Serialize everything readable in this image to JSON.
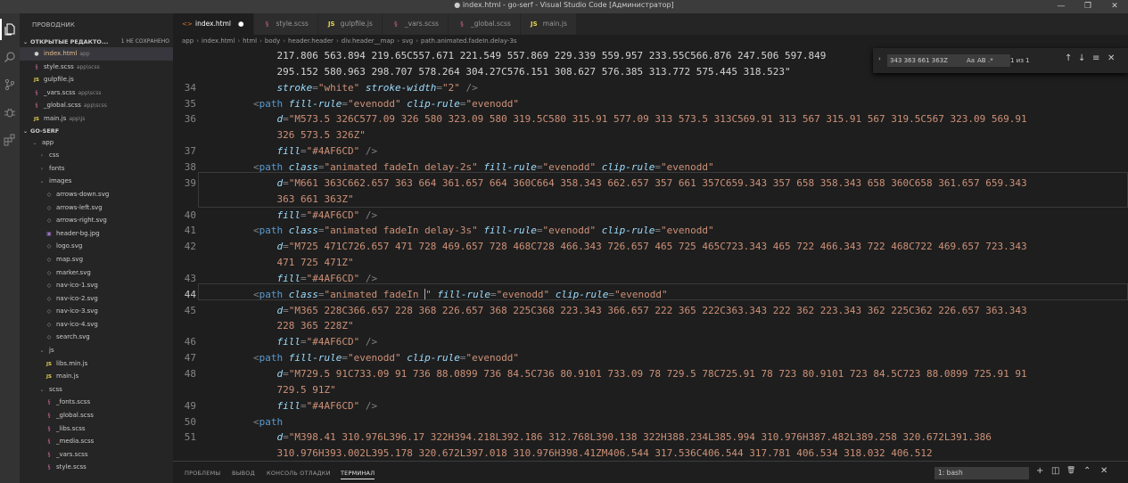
{
  "window": {
    "title": "● index.html - go-serf - Visual Studio Code [Администратор]",
    "controls": {
      "minimize": "—",
      "maximize": "❐",
      "close": "✕"
    }
  },
  "activity": [
    "files-icon",
    "search-icon",
    "source-control-icon",
    "debug-icon",
    "extensions-icon"
  ],
  "sidebar": {
    "header": "ПРОВОДНИК",
    "open_editors": {
      "label": "ОТКРЫТЫЕ РЕДАКТО...",
      "badge": "1 НЕ СОХРАНЕНО"
    },
    "open_files": [
      {
        "icon": "html",
        "name": "index.html",
        "path": "app",
        "modified": true
      },
      {
        "icon": "scss",
        "name": "style.scss",
        "path": "app\\scss"
      },
      {
        "icon": "js",
        "name": "gulpfile.js",
        "path": ""
      },
      {
        "icon": "scss",
        "name": "_vars.scss",
        "path": "app\\scss"
      },
      {
        "icon": "scss",
        "name": "_global.scss",
        "path": "app\\scss"
      },
      {
        "icon": "js",
        "name": "main.js",
        "path": "app\\js"
      }
    ],
    "project": "GO-SERF",
    "tree": [
      {
        "indent": 1,
        "type": "folder-open",
        "name": "app"
      },
      {
        "indent": 2,
        "type": "folder",
        "name": "css"
      },
      {
        "indent": 2,
        "type": "folder",
        "name": "fonts"
      },
      {
        "indent": 2,
        "type": "folder-open",
        "name": "images"
      },
      {
        "indent": 3,
        "type": "svg",
        "name": "arrows-down.svg"
      },
      {
        "indent": 3,
        "type": "svg",
        "name": "arrows-left.svg"
      },
      {
        "indent": 3,
        "type": "svg",
        "name": "arrows-right.svg"
      },
      {
        "indent": 3,
        "type": "img",
        "name": "header-bg.jpg"
      },
      {
        "indent": 3,
        "type": "svg",
        "name": "logo.svg"
      },
      {
        "indent": 3,
        "type": "svg",
        "name": "map.svg"
      },
      {
        "indent": 3,
        "type": "svg",
        "name": "marker.svg"
      },
      {
        "indent": 3,
        "type": "svg",
        "name": "nav-ico-1.svg"
      },
      {
        "indent": 3,
        "type": "svg",
        "name": "nav-ico-2.svg"
      },
      {
        "indent": 3,
        "type": "svg",
        "name": "nav-ico-3.svg"
      },
      {
        "indent": 3,
        "type": "svg",
        "name": "nav-ico-4.svg"
      },
      {
        "indent": 3,
        "type": "svg",
        "name": "search.svg"
      },
      {
        "indent": 2,
        "type": "folder-open",
        "name": "js"
      },
      {
        "indent": 3,
        "type": "js",
        "name": "libs.min.js"
      },
      {
        "indent": 3,
        "type": "js",
        "name": "main.js"
      },
      {
        "indent": 2,
        "type": "folder-open",
        "name": "scss"
      },
      {
        "indent": 3,
        "type": "scss",
        "name": "_fonts.scss"
      },
      {
        "indent": 3,
        "type": "scss",
        "name": "_global.scss"
      },
      {
        "indent": 3,
        "type": "scss",
        "name": "_libs.scss"
      },
      {
        "indent": 3,
        "type": "scss",
        "name": "_media.scss"
      },
      {
        "indent": 3,
        "type": "scss",
        "name": "_vars.scss"
      },
      {
        "indent": 3,
        "type": "scss",
        "name": "style.scss"
      }
    ]
  },
  "tabs": [
    {
      "icon": "html",
      "label": "index.html",
      "active": true,
      "dot": "●"
    },
    {
      "icon": "scss",
      "label": "style.scss"
    },
    {
      "icon": "js",
      "label": "gulpfile.js"
    },
    {
      "icon": "scss",
      "label": "_vars.scss"
    },
    {
      "icon": "scss",
      "label": "_global.scss"
    },
    {
      "icon": "js",
      "label": "main.js"
    }
  ],
  "breadcrumb": [
    "app",
    "index.html",
    "html",
    "body",
    "header.header",
    "div.header__map",
    "svg",
    "path.animated.fadeIn.delay-3s"
  ],
  "find": {
    "query": "343 363 661 363Z",
    "opt_case": "Aa",
    "opt_word": "AB",
    "opt_regex": ".*",
    "count": "1 из 1",
    "prev": "↑",
    "next": "↓",
    "menu": "≡",
    "close": "✕",
    "arrow": "›"
  },
  "editor": {
    "current_line": "44",
    "lines": [
      {
        "num": "",
        "html": "    217.806 563.894 219.65C557.671 221.549 557.869 229.339 559.957 233.55C566.876 247.506 597.849"
      },
      {
        "num": "",
        "html": "    295.152 580.963 298.707 578.264 304.27C576.151 308.627 576.385 313.772 575.445 318.523\""
      },
      {
        "num": "34",
        "html": "    <span class='attr'>stroke</span><span class='pun'>=</span><span class='val'>\"white\"</span> <span class='attr'>stroke-width</span><span class='pun'>=</span><span class='val'>\"2\"</span> <span class='pun'>/&gt;</span>"
      },
      {
        "num": "35",
        "html": "<span class='pun'>&lt;</span><span class='tag'>path</span> <span class='attr'>fill-rule</span><span class='pun'>=</span><span class='val'>\"evenodd\"</span> <span class='attr'>clip-rule</span><span class='pun'>=</span><span class='val'>\"evenodd\"</span>"
      },
      {
        "num": "36",
        "html": "    <span class='attr'>d</span><span class='pun'>=</span><span class='val'>\"M573.5 326C577.09 326 580 323.09 580 319.5C580 315.91 577.09 313 573.5 313C569.91 313 567 315.91 567 319.5C567 323.09 569.91</span>"
      },
      {
        "num": "",
        "html": "    <span class='val'>326 573.5 326Z\"</span>"
      },
      {
        "num": "37",
        "html": "    <span class='attr'>fill</span><span class='pun'>=</span><span class='val'>\"#4AF6CD\"</span> <span class='pun'>/&gt;</span>"
      },
      {
        "num": "38",
        "html": "<span class='pun'>&lt;</span><span class='tag'>path</span> <span class='attr'>class</span><span class='pun'>=</span><span class='val'>\"animated fadeIn delay-2s\"</span> <span class='attr'>fill-rule</span><span class='pun'>=</span><span class='val'>\"evenodd\"</span> <span class='attr'>clip-rule</span><span class='pun'>=</span><span class='val'>\"evenodd\"</span>"
      },
      {
        "num": "39",
        "html": "    <span class='attr'>d</span><span class='pun'>=</span><span class='val'>\"M661 363C662.657 363 664 361.657 664 360C664 358.343 662.657 357 661 357C659.343 357 658 358.343 658 360C658 361.657 659.343</span>"
      },
      {
        "num": "",
        "html": "    <span class='val'>363 661 363Z\"</span>"
      },
      {
        "num": "40",
        "html": "    <span class='attr'>fill</span><span class='pun'>=</span><span class='val'>\"#4AF6CD\"</span> <span class='pun'>/&gt;</span>"
      },
      {
        "num": "41",
        "html": "<span class='pun'>&lt;</span><span class='tag'>path</span> <span class='attr'>class</span><span class='pun'>=</span><span class='val'>\"animated fadeIn delay-3s\"</span> <span class='attr'>fill-rule</span><span class='pun'>=</span><span class='val'>\"evenodd\"</span> <span class='attr'>clip-rule</span><span class='pun'>=</span><span class='val'>\"evenodd\"</span>"
      },
      {
        "num": "42",
        "html": "    <span class='attr'>d</span><span class='pun'>=</span><span class='val'>\"M725 471C726.657 471 728 469.657 728 468C728 466.343 726.657 465 725 465C723.343 465 722 466.343 722 468C722 469.657 723.343</span>"
      },
      {
        "num": "",
        "html": "    <span class='val'>471 725 471Z\"</span>"
      },
      {
        "num": "43",
        "html": "    <span class='attr'>fill</span><span class='pun'>=</span><span class='val'>\"#4AF6CD\"</span> <span class='pun'>/&gt;</span>"
      },
      {
        "num": "44",
        "html": "<span class='pun'>&lt;</span><span class='tag'>path</span> <span class='attr'>class</span><span class='pun'>=</span><span class='val'>\"animated fadeIn <span class='cursor'></span>\"</span> <span class='attr'>fill-rule</span><span class='pun'>=</span><span class='val'>\"evenodd\"</span> <span class='attr'>clip-rule</span><span class='pun'>=</span><span class='val'>\"evenodd\"</span>"
      },
      {
        "num": "45",
        "html": "    <span class='attr'>d</span><span class='pun'>=</span><span class='val'>\"M365 228C366.657 228 368 226.657 368 225C368 223.343 366.657 222 365 222C363.343 222 362 223.343 362 225C362 226.657 363.343</span>"
      },
      {
        "num": "",
        "html": "    <span class='val'>228 365 228Z\"</span>"
      },
      {
        "num": "46",
        "html": "    <span class='attr'>fill</span><span class='pun'>=</span><span class='val'>\"#4AF6CD\"</span> <span class='pun'>/&gt;</span>"
      },
      {
        "num": "47",
        "html": "<span class='pun'>&lt;</span><span class='tag'>path</span> <span class='attr'>fill-rule</span><span class='pun'>=</span><span class='val'>\"evenodd\"</span> <span class='attr'>clip-rule</span><span class='pun'>=</span><span class='val'>\"evenodd\"</span>"
      },
      {
        "num": "48",
        "html": "    <span class='attr'>d</span><span class='pun'>=</span><span class='val'>\"M729.5 91C733.09 91 736 88.0899 736 84.5C736 80.9101 733.09 78 729.5 78C725.91 78 723 80.9101 723 84.5C723 88.0899 725.91 91</span>"
      },
      {
        "num": "",
        "html": "    <span class='val'>729.5 91Z\"</span>"
      },
      {
        "num": "49",
        "html": "    <span class='attr'>fill</span><span class='pun'>=</span><span class='val'>\"#4AF6CD\"</span> <span class='pun'>/&gt;</span>"
      },
      {
        "num": "50",
        "html": "<span class='pun'>&lt;</span><span class='tag'>path</span>"
      },
      {
        "num": "51",
        "html": "    <span class='attr'>d</span><span class='pun'>=</span><span class='val'>\"M398.41 310.976L396.17 322H394.218L392.186 312.768L390.138 322H388.234L385.994 310.976H387.482L389.258 320.672L391.386</span>"
      },
      {
        "num": "",
        "html": "    <span class='val'>310.976H393.002L395.178 320.672L397.018 310.976H398.41ZM406.544 317.536C406.544 317.781 406.534 318.032 406.512</span>"
      }
    ]
  },
  "panel": {
    "tabs": [
      "ПРОБЛЕМЫ",
      "ВЫВОД",
      "КОНСОЛЬ ОТЛАДКИ",
      "ТЕРМИНАЛ"
    ],
    "active": 3,
    "terminal_select": "1: bash",
    "buttons": {
      "add": "+",
      "split": "◫",
      "trash": "🗑",
      "maximize": "⌃",
      "close": "✕"
    }
  }
}
